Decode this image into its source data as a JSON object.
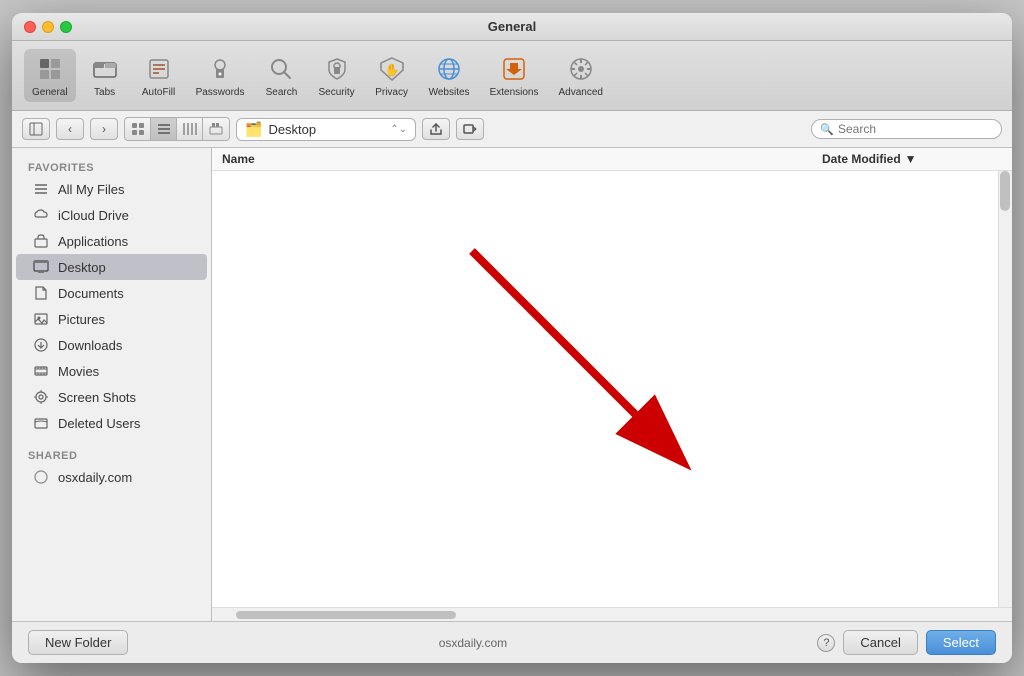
{
  "window": {
    "title": "General"
  },
  "toolbar": {
    "items": [
      {
        "id": "general",
        "label": "General",
        "icon": "⊞",
        "active": true
      },
      {
        "id": "tabs",
        "label": "Tabs",
        "icon": "⧉"
      },
      {
        "id": "autofill",
        "label": "AutoFill",
        "icon": "✏️"
      },
      {
        "id": "passwords",
        "label": "Passwords",
        "icon": "🔑"
      },
      {
        "id": "search",
        "label": "Search",
        "icon": "🔍"
      },
      {
        "id": "security",
        "label": "Security",
        "icon": "🔒"
      },
      {
        "id": "privacy",
        "label": "Privacy",
        "icon": "✋"
      },
      {
        "id": "websites",
        "label": "Websites",
        "icon": "🌐"
      },
      {
        "id": "extensions",
        "label": "Extensions",
        "icon": "🧩"
      },
      {
        "id": "advanced",
        "label": "Advanced",
        "icon": "⚙️"
      }
    ]
  },
  "navbar": {
    "location": "Desktop",
    "location_icon": "🗂️",
    "search_placeholder": "Search"
  },
  "sidebar": {
    "favorites_label": "Favorites",
    "shared_label": "Shared",
    "items_favorites": [
      {
        "id": "all-my-files",
        "label": "All My Files",
        "icon": "≡"
      },
      {
        "id": "icloud-drive",
        "label": "iCloud Drive",
        "icon": "☁"
      },
      {
        "id": "applications",
        "label": "Applications",
        "icon": "⌂"
      },
      {
        "id": "desktop",
        "label": "Desktop",
        "icon": "▦",
        "active": true
      },
      {
        "id": "documents",
        "label": "Documents",
        "icon": "📄"
      },
      {
        "id": "pictures",
        "label": "Pictures",
        "icon": "📷"
      },
      {
        "id": "downloads",
        "label": "Downloads",
        "icon": "⬇"
      },
      {
        "id": "movies",
        "label": "Movies",
        "icon": "🎬"
      },
      {
        "id": "screenshots",
        "label": "Screen Shots",
        "icon": "⚙"
      },
      {
        "id": "deleted-users",
        "label": "Deleted Users",
        "icon": "▭"
      }
    ],
    "items_shared": [
      {
        "id": "osxdaily",
        "label": "osxdaily.com",
        "icon": ""
      }
    ]
  },
  "file_area": {
    "col_name": "Name",
    "col_date": "Date Modified"
  },
  "bottom_bar": {
    "new_folder_label": "New Folder",
    "website_label": "osxdaily.com",
    "cancel_label": "Cancel",
    "select_label": "Select",
    "help_label": "?"
  }
}
